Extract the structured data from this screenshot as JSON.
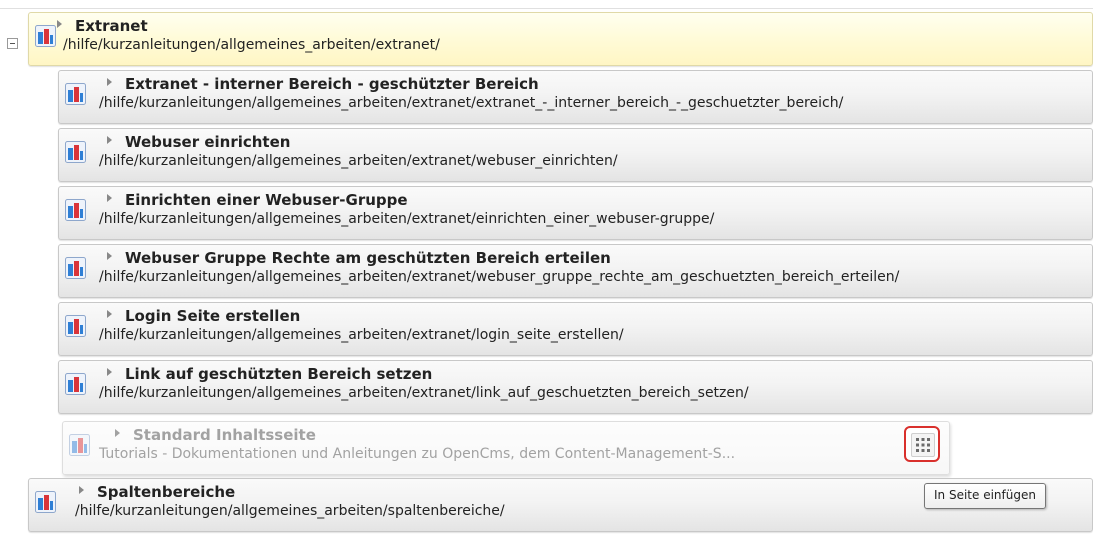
{
  "tree": {
    "parent": {
      "title": "Extranet",
      "path": "/hilfe/kurzanleitungen/allgemeines_arbeiten/extranet/"
    },
    "children": [
      {
        "title": "Extranet - interner Bereich - geschützter Bereich",
        "path": "/hilfe/kurzanleitungen/allgemeines_arbeiten/extranet/extranet_-_interner_bereich_-_geschuetzter_bereich/"
      },
      {
        "title": "Webuser einrichten",
        "path": "/hilfe/kurzanleitungen/allgemeines_arbeiten/extranet/webuser_einrichten/"
      },
      {
        "title": "Einrichten einer Webuser-Gruppe",
        "path": "/hilfe/kurzanleitungen/allgemeines_arbeiten/extranet/einrichten_einer_webuser-gruppe/"
      },
      {
        "title": "Webuser Gruppe Rechte am geschützten Bereich erteilen",
        "path": "/hilfe/kurzanleitungen/allgemeines_arbeiten/extranet/webuser_gruppe_rechte_am_geschuetzten_bereich_erteilen/"
      },
      {
        "title": "Login Seite erstellen",
        "path": "/hilfe/kurzanleitungen/allgemeines_arbeiten/extranet/login_seite_erstellen/"
      },
      {
        "title": "Link auf geschützten Bereich setzen",
        "path": "/hilfe/kurzanleitungen/allgemeines_arbeiten/extranet/link_auf_geschuetzten_bereich_setzen/"
      }
    ],
    "dragged": {
      "title": "Standard Inhaltsseite",
      "path": "Tutorials - Dokumentationen und Anleitungen zu OpenCms, dem Content-Management-S..."
    },
    "sibling": {
      "title": "Spaltenbereiche",
      "path": "/hilfe/kurzanleitungen/allgemeines_arbeiten/spaltenbereiche/"
    }
  },
  "tooltip": {
    "text": "In Seite einfügen"
  },
  "icons": {
    "collapse": "minus-box-icon",
    "page": "page-type-icon",
    "expand_arrow": "triangle-right-icon",
    "insert": "grid-dots-icon"
  },
  "colors": {
    "highlight_row": "#fff9d6",
    "button_border": "#d9302c",
    "icon_blue": "#2f7fd5",
    "icon_red": "#d9343a"
  }
}
